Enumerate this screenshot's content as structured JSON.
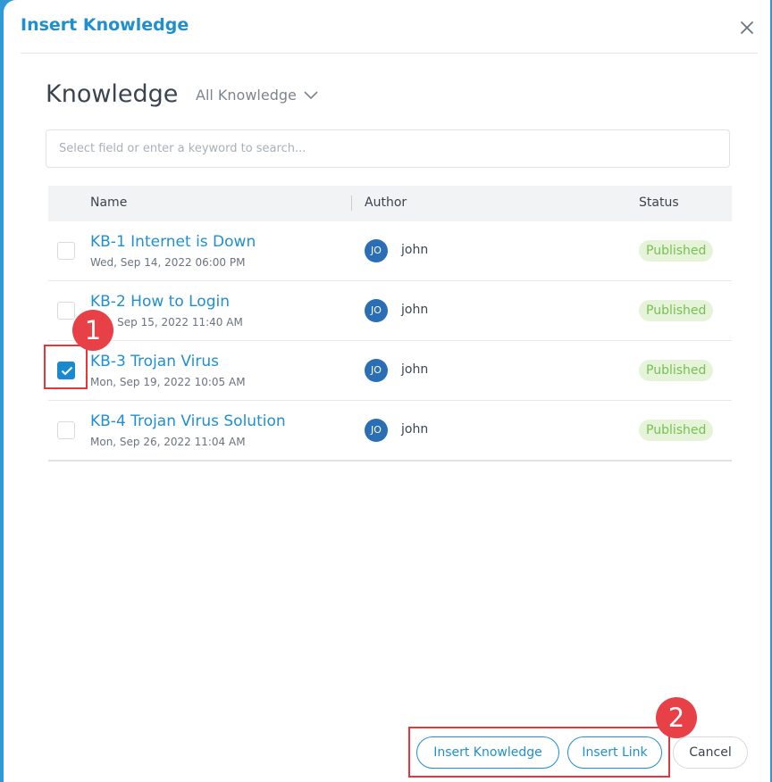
{
  "dialog": {
    "title": "Insert Knowledge"
  },
  "section": {
    "title": "Knowledge",
    "filter_label": "All Knowledge"
  },
  "search": {
    "placeholder": "Select field or enter a keyword to search..."
  },
  "table": {
    "columns": [
      "Name",
      "Author",
      "Status"
    ],
    "rows": [
      {
        "name": "KB-1 Internet is Down",
        "date": "Wed, Sep 14, 2022 06:00 PM",
        "author_initials": "JO",
        "author": "john",
        "status": "Published",
        "checked": false
      },
      {
        "name": "KB-2 How to Login",
        "date": "Thu, Sep 15, 2022 11:40 AM",
        "author_initials": "JO",
        "author": "john",
        "status": "Published",
        "checked": false
      },
      {
        "name": "KB-3 Trojan Virus",
        "date": "Mon, Sep 19, 2022 10:05 AM",
        "author_initials": "JO",
        "author": "john",
        "status": "Published",
        "checked": true
      },
      {
        "name": "KB-4 Trojan Virus Solution",
        "date": "Mon, Sep 26, 2022 11:04 AM",
        "author_initials": "JO",
        "author": "john",
        "status": "Published",
        "checked": false
      }
    ]
  },
  "buttons": {
    "insert_knowledge": "Insert Knowledge",
    "insert_link": "Insert Link",
    "cancel": "Cancel"
  },
  "markers": [
    "1",
    "2"
  ],
  "colors": {
    "accent": "#1f8fd0",
    "status_published_bg": "#e5f4d8",
    "status_published_text": "#78bf54",
    "marker": "#e74046"
  }
}
